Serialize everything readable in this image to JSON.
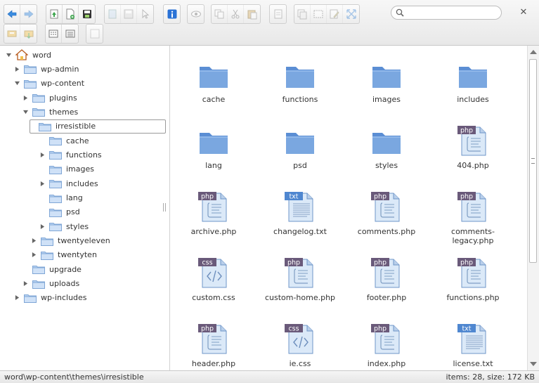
{
  "toolbar": {
    "row1": [
      {
        "group": "history",
        "buttons": [
          {
            "icon": "back-icon",
            "enabled": true
          },
          {
            "icon": "forward-icon",
            "enabled": false
          }
        ]
      },
      {
        "group": "file",
        "buttons": [
          {
            "icon": "upload-icon",
            "enabled": true
          },
          {
            "icon": "new-file-icon",
            "enabled": true
          },
          {
            "icon": "save-icon",
            "enabled": true
          }
        ]
      },
      {
        "group": "open",
        "buttons": [
          {
            "icon": "open-icon",
            "enabled": false
          },
          {
            "icon": "download-icon",
            "enabled": false
          },
          {
            "icon": "select-icon",
            "enabled": false
          }
        ]
      },
      {
        "group": "info",
        "buttons": [
          {
            "icon": "info-icon",
            "enabled": true
          }
        ]
      },
      {
        "group": "view",
        "buttons": [
          {
            "icon": "preview-icon",
            "enabled": false
          }
        ]
      },
      {
        "group": "edit",
        "buttons": [
          {
            "icon": "copy-icon",
            "enabled": false
          },
          {
            "icon": "cut-icon",
            "enabled": false
          },
          {
            "icon": "paste-icon",
            "enabled": false
          }
        ]
      },
      {
        "group": "delete",
        "buttons": [
          {
            "icon": "delete-icon",
            "enabled": false
          }
        ]
      },
      {
        "group": "tools",
        "buttons": [
          {
            "icon": "duplicate-icon",
            "enabled": false
          },
          {
            "icon": "rename-icon",
            "enabled": false
          },
          {
            "icon": "edit-file-icon",
            "enabled": false
          },
          {
            "icon": "resize-icon",
            "enabled": false
          }
        ]
      }
    ],
    "row2": [
      {
        "group": "archive",
        "buttons": [
          {
            "icon": "archive-icon",
            "enabled": false
          },
          {
            "icon": "extract-icon",
            "enabled": false
          }
        ]
      },
      {
        "group": "display",
        "buttons": [
          {
            "icon": "icons-view-icon",
            "enabled": true
          },
          {
            "icon": "list-view-icon",
            "enabled": true
          }
        ]
      },
      {
        "group": "help",
        "buttons": [
          {
            "icon": "help-icon",
            "enabled": false
          }
        ]
      }
    ],
    "search": {
      "placeholder": "",
      "value": ""
    },
    "close_label": "✕"
  },
  "tree": [
    {
      "label": "word",
      "depth": 0,
      "expanded": true,
      "has_children": true,
      "icon": "home-icon"
    },
    {
      "label": "wp-admin",
      "depth": 1,
      "expanded": false,
      "has_children": true
    },
    {
      "label": "wp-content",
      "depth": 1,
      "expanded": true,
      "has_children": true
    },
    {
      "label": "plugins",
      "depth": 2,
      "expanded": false,
      "has_children": true
    },
    {
      "label": "themes",
      "depth": 2,
      "expanded": true,
      "has_children": true
    },
    {
      "label": "irresistible",
      "depth": 3,
      "expanded": true,
      "has_children": false,
      "selected": true,
      "open": true
    },
    {
      "label": "cache",
      "depth": 4,
      "expanded": false,
      "has_children": false
    },
    {
      "label": "functions",
      "depth": 4,
      "expanded": false,
      "has_children": true
    },
    {
      "label": "images",
      "depth": 4,
      "expanded": false,
      "has_children": false
    },
    {
      "label": "includes",
      "depth": 4,
      "expanded": false,
      "has_children": true
    },
    {
      "label": "lang",
      "depth": 4,
      "expanded": false,
      "has_children": false
    },
    {
      "label": "psd",
      "depth": 4,
      "expanded": false,
      "has_children": false
    },
    {
      "label": "styles",
      "depth": 4,
      "expanded": false,
      "has_children": true
    },
    {
      "label": "twentyeleven",
      "depth": 3,
      "expanded": false,
      "has_children": true
    },
    {
      "label": "twentyten",
      "depth": 3,
      "expanded": false,
      "has_children": true
    },
    {
      "label": "upgrade",
      "depth": 2,
      "expanded": false,
      "has_children": false
    },
    {
      "label": "uploads",
      "depth": 2,
      "expanded": false,
      "has_children": true
    },
    {
      "label": "wp-includes",
      "depth": 1,
      "expanded": false,
      "has_children": true
    }
  ],
  "files": [
    {
      "name": "cache",
      "kind": "folder"
    },
    {
      "name": "functions",
      "kind": "folder"
    },
    {
      "name": "images",
      "kind": "folder"
    },
    {
      "name": "includes",
      "kind": "folder"
    },
    {
      "name": "lang",
      "kind": "folder"
    },
    {
      "name": "psd",
      "kind": "folder"
    },
    {
      "name": "styles",
      "kind": "folder"
    },
    {
      "name": "404.php",
      "kind": "php",
      "badge": "php"
    },
    {
      "name": "archive.php",
      "kind": "php",
      "badge": "php"
    },
    {
      "name": "changelog.txt",
      "kind": "txt",
      "badge": "txt"
    },
    {
      "name": "comments.php",
      "kind": "php",
      "badge": "php"
    },
    {
      "name": "comments-legacy.php",
      "kind": "php",
      "badge": "php"
    },
    {
      "name": "custom.css",
      "kind": "css",
      "badge": "css"
    },
    {
      "name": "custom-home.php",
      "kind": "php",
      "badge": "php"
    },
    {
      "name": "footer.php",
      "kind": "php",
      "badge": "php"
    },
    {
      "name": "functions.php",
      "kind": "php",
      "badge": "php"
    },
    {
      "name": "header.php",
      "kind": "php",
      "badge": "php"
    },
    {
      "name": "ie.css",
      "kind": "css",
      "badge": "css"
    },
    {
      "name": "index.php",
      "kind": "php",
      "badge": "php"
    },
    {
      "name": "license.txt",
      "kind": "txt",
      "badge": "txt"
    }
  ],
  "status": {
    "path": "word\\wp-content\\themes\\irresistible",
    "info": "items: 28, size: 172 KB"
  },
  "colors": {
    "folder": "#7aa7e0",
    "folder_dark": "#5b8ed4",
    "badge": "#6a5a7a",
    "doc": "#dbe9f8",
    "accent_blue": "#2a72d6"
  }
}
